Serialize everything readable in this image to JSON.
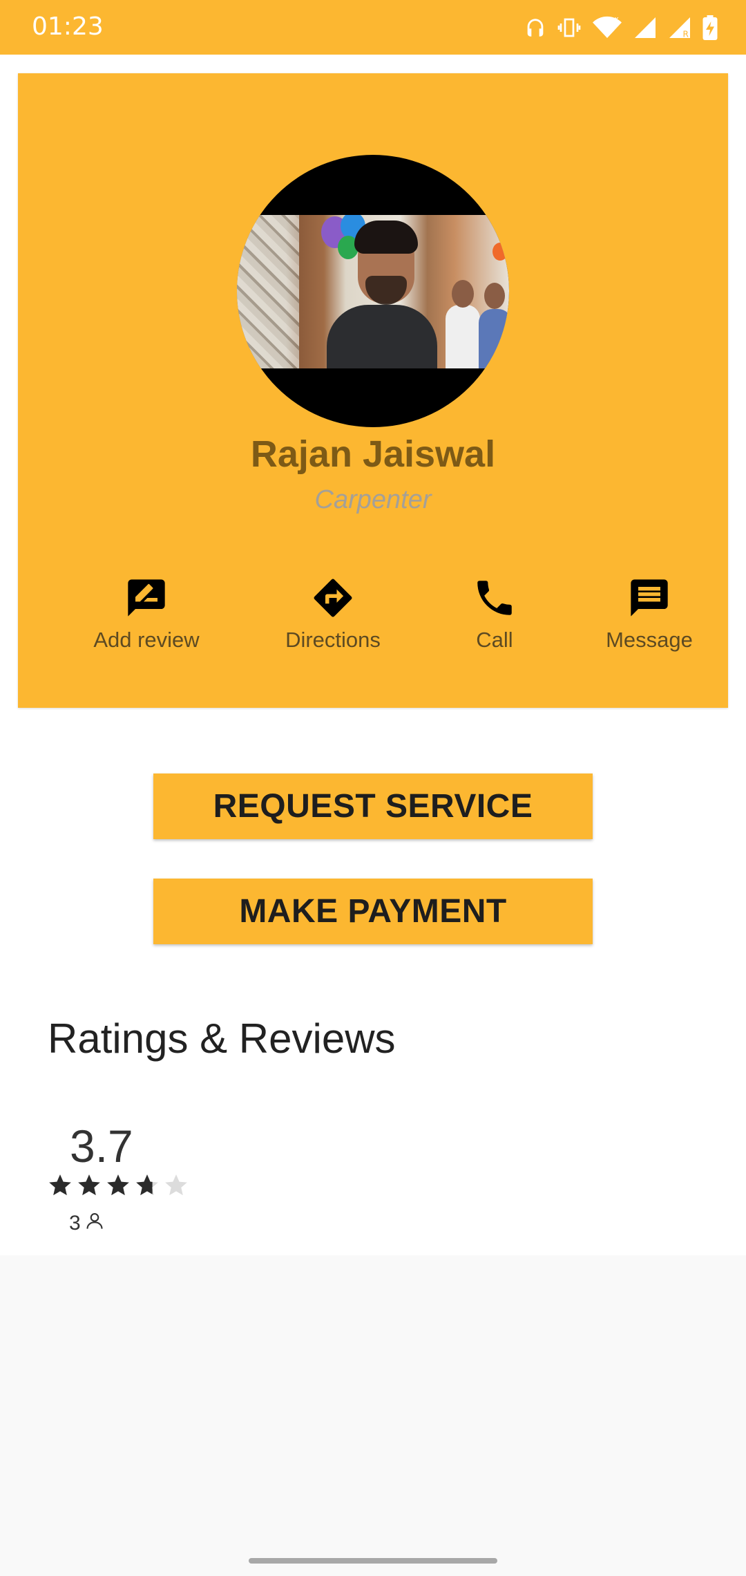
{
  "status_bar": {
    "time": "01:23",
    "icons": [
      "headphones-icon",
      "vibrate-icon",
      "wifi-icon",
      "signal-icon",
      "signal-roaming-icon",
      "battery-charging-icon"
    ]
  },
  "profile": {
    "name": "Rajan Jaiswal",
    "profession": "Carpenter",
    "avatar": "profile-photo"
  },
  "actions": [
    {
      "label": "Add review",
      "icon": "rate-review-icon"
    },
    {
      "label": "Directions",
      "icon": "directions-icon"
    },
    {
      "label": "Call",
      "icon": "phone-icon"
    },
    {
      "label": "Message",
      "icon": "message-icon"
    }
  ],
  "buttons": {
    "request_service": "REQUEST SERVICE",
    "make_payment": "MAKE PAYMENT"
  },
  "ratings": {
    "title": "Ratings & Reviews",
    "average": "3.7",
    "stars_filled": 3.7,
    "stars_total": 5,
    "count": "3",
    "count_icon": "person-icon"
  },
  "colors": {
    "accent": "#fcb731",
    "name_text": "#7d5a16",
    "profession_text": "#a4a098"
  }
}
